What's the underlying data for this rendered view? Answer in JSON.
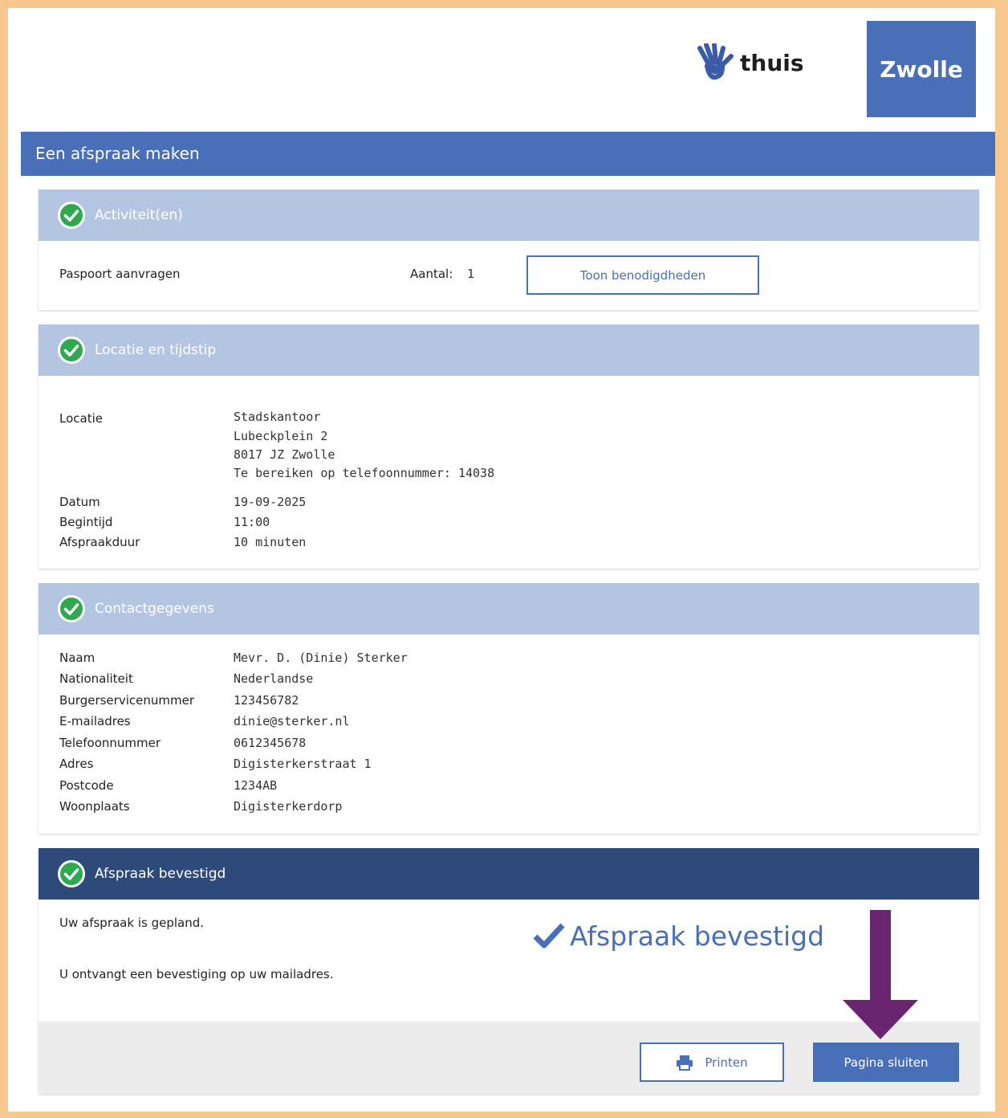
{
  "brand": {
    "logo_text": "thuis",
    "city": "Zwolle"
  },
  "page_title": "Een afspraak maken",
  "activities": {
    "header": "Activiteit(en)",
    "item_name": "Paspoort aanvragen",
    "count_label": "Aantal:",
    "count_value": "1",
    "show_button": "Toon benodigdheden"
  },
  "location": {
    "header": "Locatie en tijdstip",
    "location_label": "Locatie",
    "location_lines": [
      "Stadskantoor",
      "Lubeckplein 2",
      "8017 JZ Zwolle",
      "Te bereiken op telefoonnummer: 14038"
    ],
    "date_label": "Datum",
    "date_value": "19-09-2025",
    "start_label": "Begintijd",
    "start_value": "11:00",
    "duration_label": "Afspraakduur",
    "duration_value": "10 minuten"
  },
  "contact": {
    "header": "Contactgegevens",
    "rows": [
      {
        "label": "Naam",
        "value": "Mevr. D. (Dinie) Sterker"
      },
      {
        "label": "Nationaliteit",
        "value": "Nederlandse"
      },
      {
        "label": "Burgerservicenummer",
        "value": "123456782"
      },
      {
        "label": "E-mailadres",
        "value": "dinie@sterker.nl"
      },
      {
        "label": "Telefoonnummer",
        "value": "0612345678"
      },
      {
        "label": "Adres",
        "value": "Digisterkerstraat 1"
      },
      {
        "label": "Postcode",
        "value": "1234AB"
      },
      {
        "label": "Woonplaats",
        "value": "Digisterkerdorp"
      }
    ]
  },
  "confirmation": {
    "header": "Afspraak bevestigd",
    "line1": "Uw afspraak is gepland.",
    "line2": "U ontvangt een bevestiging op uw mailadres.",
    "big_text": "Afspraak bevestigd",
    "print_button": "Printen",
    "close_button": "Pagina sluiten"
  },
  "colors": {
    "primary": "#486fb7",
    "section_header": "#b4c5e2",
    "confirm_header": "#2e4a7b",
    "check_green": "#2fa84f",
    "arrow": "#6a2570",
    "frame": "#f6c88f"
  },
  "icons": [
    "hand-logo-icon",
    "check-circle-icon",
    "checkmark-icon",
    "printer-icon",
    "down-arrow-icon"
  ]
}
